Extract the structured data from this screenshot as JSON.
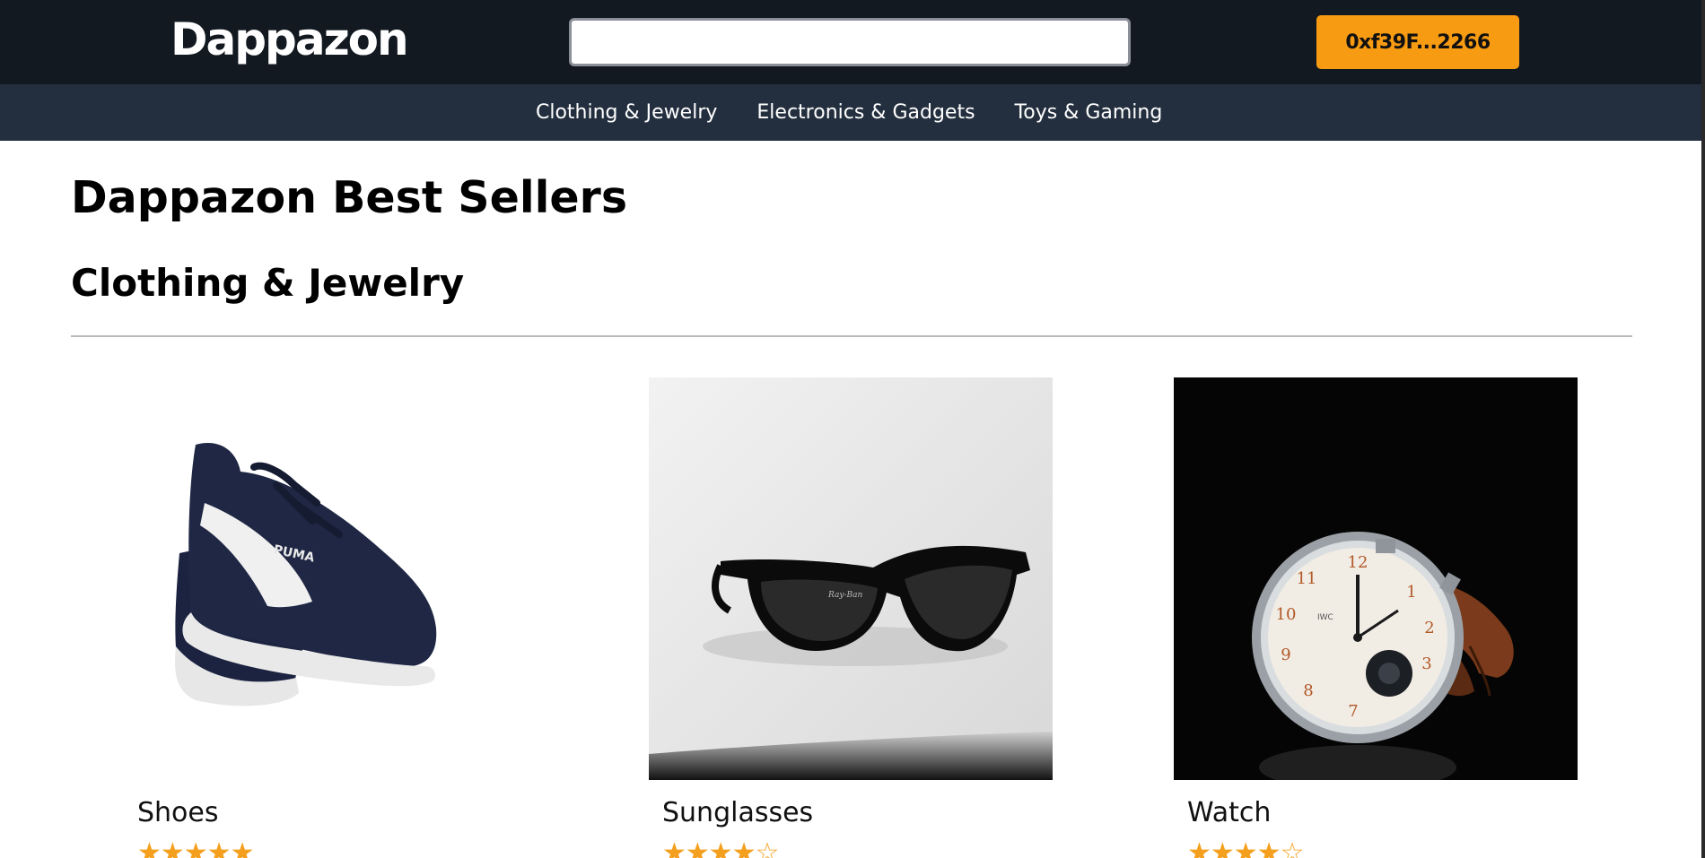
{
  "brand": {
    "name": "Dappazon"
  },
  "search": {
    "value": "",
    "placeholder": ""
  },
  "account": {
    "label": "0xf39F...2266"
  },
  "categories": [
    {
      "label": "Clothing & Jewelry"
    },
    {
      "label": "Electronics & Gadgets"
    },
    {
      "label": "Toys & Gaming"
    }
  ],
  "main": {
    "title": "Dappazon Best Sellers",
    "section_title": "Clothing & Jewelry"
  },
  "products": [
    {
      "name": "Shoes",
      "rating": 5,
      "max_rating": 5,
      "stars": "★★★★★"
    },
    {
      "name": "Sunglasses",
      "rating": 4,
      "max_rating": 5,
      "stars": "★★★★☆"
    },
    {
      "name": "Watch",
      "rating": 4,
      "max_rating": 5,
      "stars": "★★★★☆"
    }
  ],
  "colors": {
    "header_bg": "#131921",
    "nav_bg": "#232f3e",
    "accent": "#f79b12",
    "star": "#f4a01e"
  }
}
